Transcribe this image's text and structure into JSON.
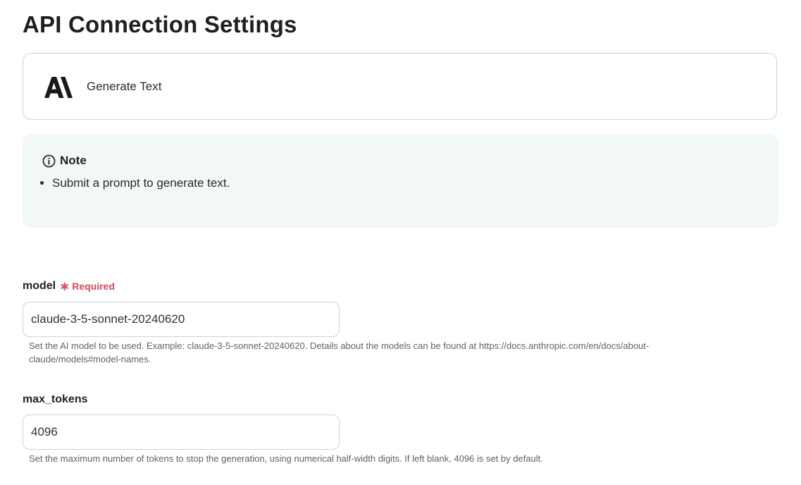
{
  "page": {
    "title": "API Connection Settings"
  },
  "action": {
    "logo_icon": "anthropic-logo",
    "label": "Generate Text"
  },
  "note": {
    "icon": "info-icon",
    "title": "Note",
    "items": [
      "Submit a prompt to generate text."
    ]
  },
  "fields": [
    {
      "label": "model",
      "required_text": "Required",
      "value": "claude-3-5-sonnet-20240620",
      "help": "Set the AI model to be used. Example: claude-3-5-sonnet-20240620. Details about the models can be found at https://docs.anthropic.com/en/docs/about-claude/models#model-names."
    },
    {
      "label": "max_tokens",
      "value": "4096",
      "help": "Set the maximum number of tokens to stop the generation, using numerical half-width digits. If left blank, 4096 is set by default."
    }
  ],
  "colors": {
    "required": "#e2455a",
    "note_background": "#f1f8f7",
    "border": "#cfd2d4"
  }
}
